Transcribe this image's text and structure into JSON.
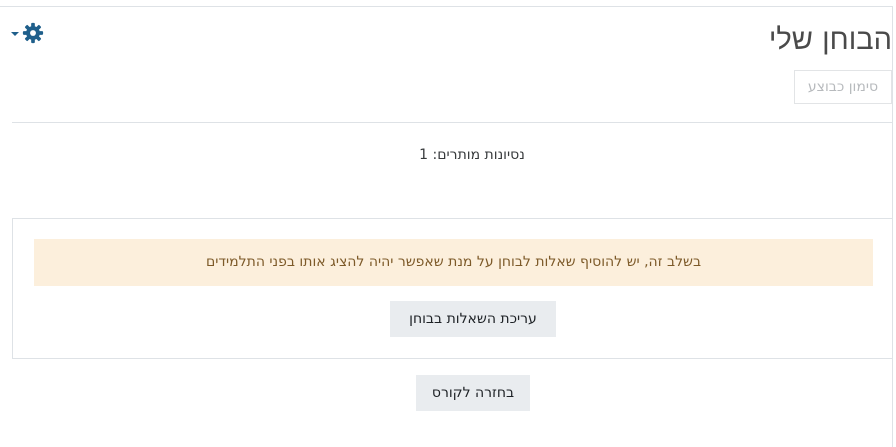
{
  "header": {
    "title": "הבוחן שלי",
    "mark_done_label": "סימון כבוצע",
    "settings_icon": "gear-icon",
    "settings_caret_icon": "caret-down-icon"
  },
  "quiz_info": {
    "attempts_text": "נסיונות מותרים: 1"
  },
  "notice": {
    "message": "בשלב זה, יש להוסיף שאלות לבוחן על מנת שאפשר יהיה להציג אותו בפני התלמידים",
    "edit_button_label": "עריכת השאלות בבוחן"
  },
  "footer": {
    "back_button_label": "בחזרה לקורס"
  },
  "colors": {
    "accent": "#1f5f8b",
    "alert_bg": "#fcefdc",
    "alert_text": "#7d5a29",
    "secondary_btn": "#e9ecef"
  }
}
